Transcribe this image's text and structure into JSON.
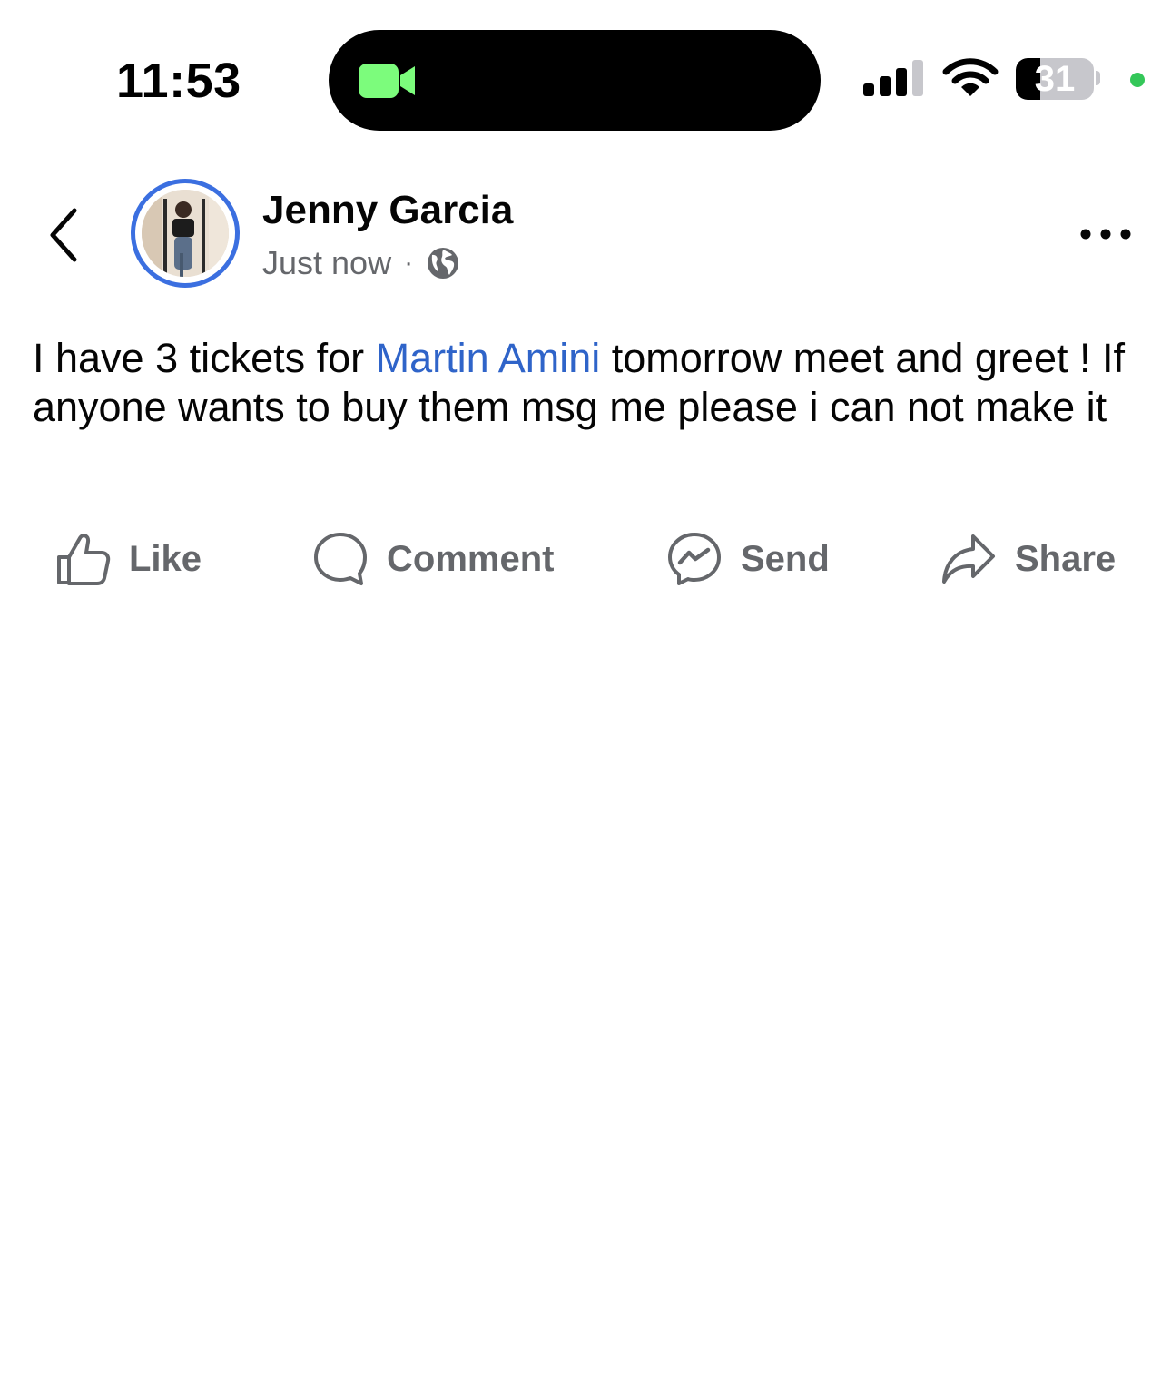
{
  "status_bar": {
    "time": "11:53",
    "battery_level": "31",
    "battery_fraction": 0.31,
    "icons": [
      "facetime-video-icon",
      "cellular-signal-icon",
      "wifi-icon",
      "battery-icon",
      "privacy-indicator-dot"
    ]
  },
  "post": {
    "author": "Jenny Garcia",
    "timestamp": "Just now",
    "separator": "·",
    "audience_icon": "globe-icon",
    "text_before_mention": "I have 3 tickets for ",
    "mention": "Martin Amini",
    "text_after_mention": " tomorrow meet and greet ! If anyone wants to buy them msg me please i can not make it"
  },
  "actions": {
    "like": "Like",
    "comment": "Comment",
    "send": "Send",
    "share": "Share"
  },
  "colors": {
    "mention": "#2f64c9",
    "secondary_text": "#65676b",
    "avatar_ring": "#3b6fe0",
    "facetime_green": "#7cfc7c"
  }
}
